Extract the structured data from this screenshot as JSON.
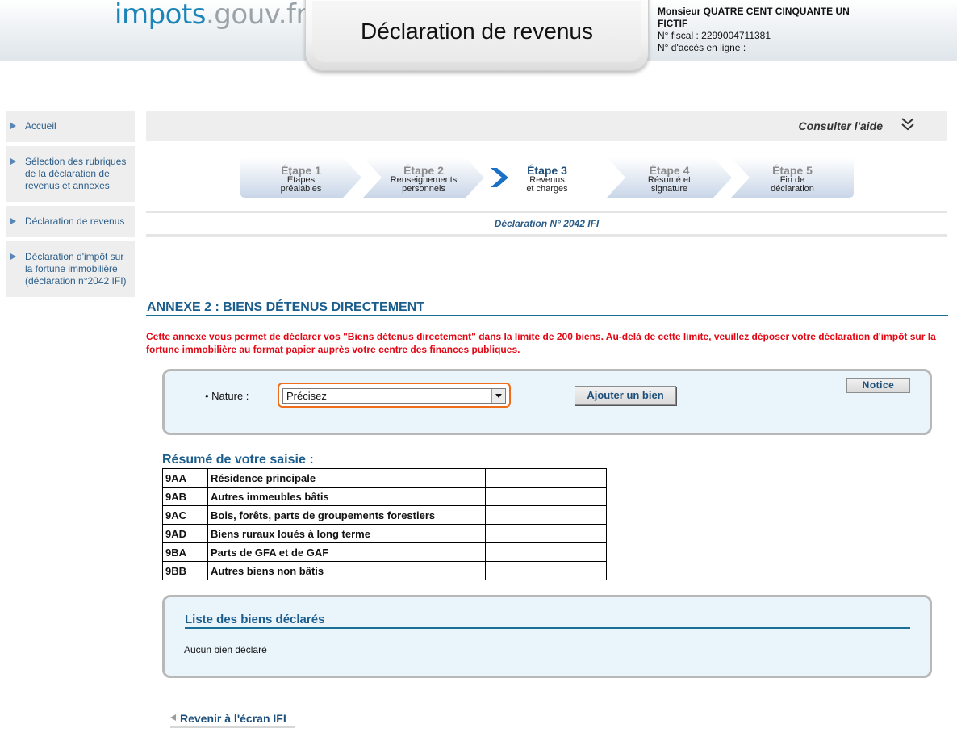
{
  "header": {
    "logo_part1": "impots",
    "logo_part2": ".gouv.fr",
    "title": "Déclaration de revenus",
    "user_name": "Monsieur QUATRE CENT CINQUANTE UN FICTIF",
    "fiscal_number": "N° fiscal : 2299004711381",
    "access_number": "N° d'accès en ligne :"
  },
  "sidebar": {
    "items": [
      {
        "label": "Accueil"
      },
      {
        "label": "Sélection des rubriques de la déclaration de revenus et annexes"
      },
      {
        "label": "Déclaration de revenus"
      },
      {
        "label": "Déclaration d'impôt sur la fortune immobilière (déclaration n°2042 IFI)"
      }
    ]
  },
  "help": {
    "label": "Consulter l'aide",
    "icon": "double-chevron-down-icon"
  },
  "steps": [
    {
      "title": "Étape 1",
      "sub1": "Étapes",
      "sub2": "préalables"
    },
    {
      "title": "Étape 2",
      "sub1": "Renseignements",
      "sub2": "personnels"
    },
    {
      "title": "Étape 3",
      "sub1": "Revenus",
      "sub2": "et charges"
    },
    {
      "title": "Étape 4",
      "sub1": "Résumé et",
      "sub2": "signature"
    },
    {
      "title": "Étape 5",
      "sub1": "Fin de",
      "sub2": "déclaration"
    }
  ],
  "declaration_number": "Déclaration N° 2042 IFI",
  "annexe": {
    "title": "ANNEXE 2 : BIENS DÉTENUS DIRECTEMENT",
    "intro": "Cette annexe vous permet de déclarer vos \"Biens détenus directement\" dans la limite de 200 biens. Au-delà de cette limite, veuillez déposer votre déclaration d'impôt sur la fortune immobilière au format papier auprès votre centre des finances publiques."
  },
  "form": {
    "nature_label": "Nature :",
    "nature_selected": "Précisez",
    "add_button": "Ajouter un bien",
    "notice_button": "Notice"
  },
  "resume": {
    "title": "Résumé de votre saisie :",
    "rows": [
      {
        "code": "9AA",
        "label": "Résidence principale",
        "value": ""
      },
      {
        "code": "9AB",
        "label": "Autres immeubles bâtis",
        "value": ""
      },
      {
        "code": "9AC",
        "label": "Bois, forêts, parts de groupements forestiers",
        "value": ""
      },
      {
        "code": "9AD",
        "label": "Biens ruraux loués à long terme",
        "value": ""
      },
      {
        "code": "9BA",
        "label": "Parts de GFA et de GAF",
        "value": ""
      },
      {
        "code": "9BB",
        "label": "Autres biens non bâtis",
        "value": ""
      }
    ]
  },
  "liste": {
    "title": "Liste des biens déclarés",
    "empty_text": "Aucun bien déclaré"
  },
  "back_link": "Revenir à l'écran IFI",
  "colors": {
    "accent_blue": "#1b5d8c",
    "warning_red": "#e30613",
    "focus_orange": "#ef6c1a",
    "panel_bg": "#eaf4fb"
  }
}
